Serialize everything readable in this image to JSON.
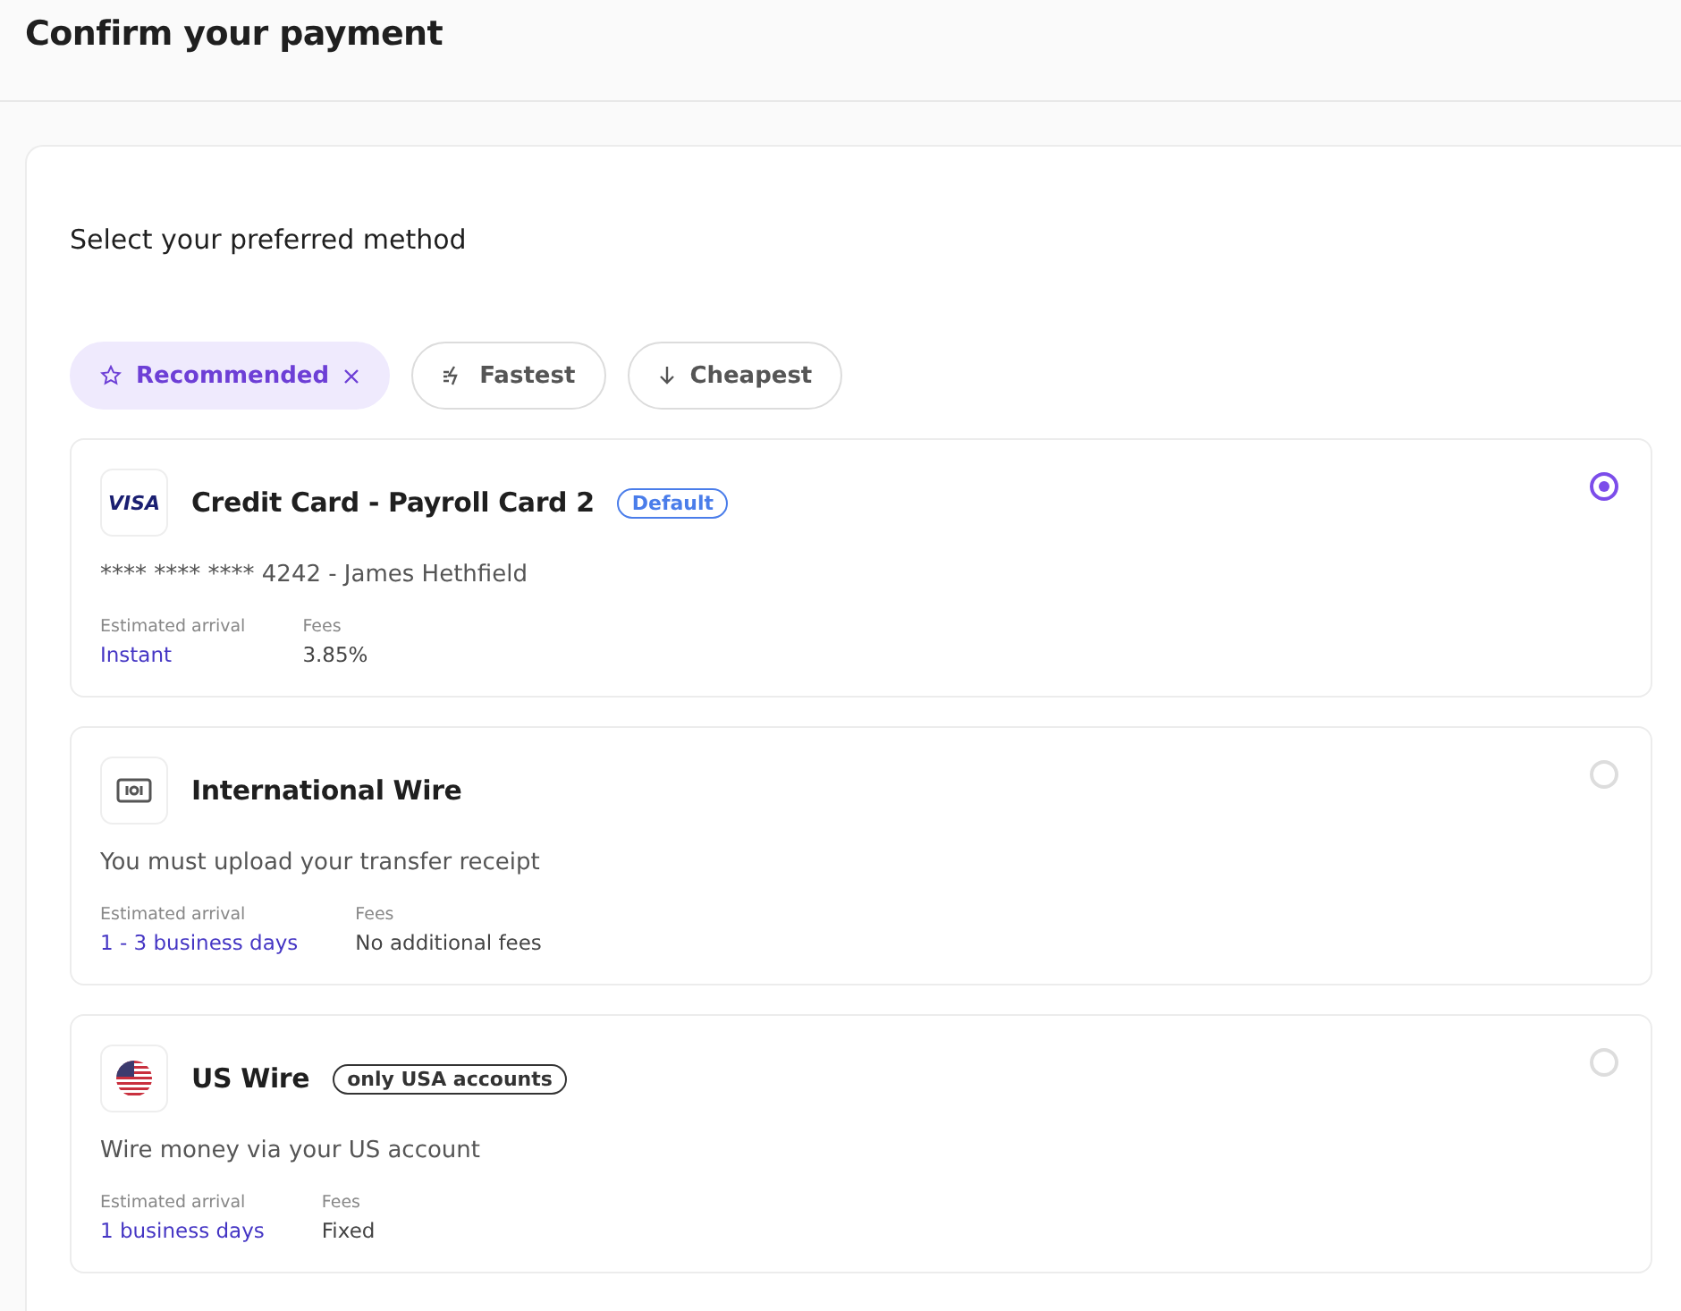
{
  "page": {
    "title": "Confirm your payment"
  },
  "section": {
    "title": "Select your preferred method"
  },
  "filters": [
    {
      "label": "Recommended",
      "selected": true
    },
    {
      "label": "Fastest",
      "selected": false
    },
    {
      "label": "Cheapest",
      "selected": false
    }
  ],
  "methods": [
    {
      "logo_text": "VISA",
      "name": "Credit Card - Payroll Card 2",
      "badge": {
        "label": "Default",
        "kind": "info"
      },
      "description": "**** **** **** 4242 - James Hethfield",
      "arrival_label": "Estimated arrival",
      "arrival": "Instant",
      "fees_label": "Fees",
      "fees": "3.85%",
      "selected": true
    },
    {
      "name": "International Wire",
      "description": "You must upload your transfer receipt",
      "arrival_label": "Estimated arrival",
      "arrival": "1 - 3 business days",
      "fees_label": "Fees",
      "fees": "No additional fees",
      "selected": false
    },
    {
      "name": "US Wire",
      "badge": {
        "label": "only USA accounts",
        "kind": "neutral"
      },
      "description": "Wire money via your US account",
      "arrival_label": "Estimated arrival",
      "arrival": "1 business days",
      "fees_label": "Fees",
      "fees": "Fixed",
      "selected": false
    }
  ]
}
